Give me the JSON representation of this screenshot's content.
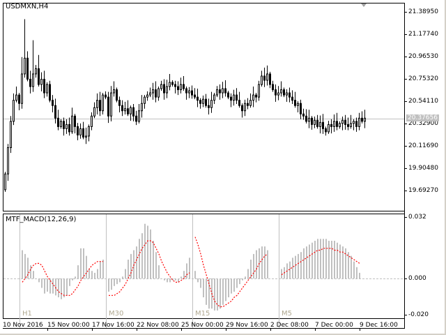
{
  "main": {
    "symbol_label": "USDMXN,H4",
    "current_price": "20.37656",
    "price_axis": [
      "21.38950",
      "21.17740",
      "20.96530",
      "20.75320",
      "20.54110",
      "20.32900",
      "20.11690",
      "19.90480",
      "19.69270"
    ],
    "colors": {
      "candle": "#000000",
      "grid_line": "#c0c0c0",
      "current_price_bg": "#c0c0c0"
    }
  },
  "indicator": {
    "title": "MTF_MACD(12,26,9)",
    "axis": [
      "0.032",
      "0.000",
      "-0.020"
    ],
    "timeframes": [
      "H1",
      "M30",
      "M15",
      "M5"
    ],
    "colors": {
      "histogram": "#c0c0c0",
      "signal": "#ff0000",
      "timeframe_label": "#b0a890"
    }
  },
  "time_axis": [
    "10 Nov 2016",
    "15 Nov 00:00",
    "17 Nov 16:00",
    "22 Nov 08:00",
    "25 Nov 00:00",
    "29 Nov 16:00",
    "2 Dec 08:00",
    "7 Dec 00:00",
    "9 Dec 16:00"
  ],
  "chart_data": [
    {
      "type": "candlestick",
      "title": "USDMXN,H4",
      "ylim": [
        19.55,
        21.45
      ],
      "open_first": 19.7,
      "closes": [
        19.85,
        20.1,
        20.35,
        20.55,
        20.6,
        20.52,
        20.8,
        20.95,
        20.75,
        20.68,
        20.8,
        20.85,
        20.7,
        20.75,
        20.62,
        20.7,
        20.55,
        20.5,
        20.38,
        20.3,
        20.35,
        20.28,
        20.32,
        20.25,
        20.4,
        20.3,
        20.22,
        20.28,
        20.2,
        20.21,
        20.3,
        20.4,
        20.48,
        20.55,
        20.45,
        20.6,
        20.58,
        20.4,
        20.62,
        20.65,
        20.55,
        20.5,
        20.45,
        20.47,
        20.42,
        20.48,
        20.4,
        20.35,
        20.45,
        20.52,
        20.58,
        20.6,
        20.62,
        20.65,
        20.58,
        20.66,
        20.7,
        20.62,
        20.68,
        20.72,
        20.7,
        20.68,
        20.65,
        20.7,
        20.66,
        20.62,
        20.64,
        20.6,
        20.58,
        20.55,
        20.52,
        20.56,
        20.5,
        20.48,
        20.55,
        20.6,
        20.65,
        20.62,
        20.66,
        20.62,
        20.58,
        20.55,
        20.6,
        20.55,
        20.5,
        20.45,
        20.52,
        20.5,
        20.55,
        20.6,
        20.58,
        20.7,
        20.78,
        20.74,
        20.8,
        20.7,
        20.65,
        20.6,
        20.62,
        20.65,
        20.6,
        20.62,
        20.58,
        20.55,
        20.5,
        20.52,
        20.42,
        20.4,
        20.35,
        20.38,
        20.32,
        20.36,
        20.3,
        20.34,
        20.28,
        20.25,
        20.32,
        20.3,
        20.35,
        20.3,
        20.33,
        20.36,
        20.32,
        20.3,
        20.33,
        20.35,
        20.3,
        20.38,
        20.35,
        20.38
      ],
      "high_overrides": {
        "7": 21.32,
        "10": 21.12,
        "12": 20.98,
        "6": 20.96,
        "93": 20.86
      }
    },
    {
      "type": "bar+line",
      "title": "MTF_MACD(12,26,9)",
      "ylim": [
        -0.02,
        0.032
      ],
      "segments": [
        {
          "name": "H1",
          "histogram": [
            15,
            13,
            11,
            7,
            4,
            0,
            -2,
            -5,
            -8,
            -7,
            -8,
            -8,
            -9,
            -10,
            -11,
            -10,
            -9,
            -4,
            -1,
            1,
            7,
            16,
            16,
            12,
            5,
            4,
            3,
            5,
            9,
            10
          ],
          "signal": [
            -2,
            0,
            2,
            5,
            7,
            8,
            8,
            7,
            4,
            1,
            -1,
            -3,
            -5,
            -7,
            -8,
            -9,
            -9,
            -9,
            -8,
            -6,
            -4,
            -1,
            1,
            3,
            5,
            7,
            8,
            9,
            9,
            9
          ]
        },
        {
          "name": "M30",
          "histogram": [
            -7,
            -6,
            -4,
            -3,
            -2,
            1,
            5,
            10,
            13,
            15,
            17,
            21,
            24,
            29,
            28,
            26,
            20,
            14,
            7,
            0,
            -1,
            -2,
            -2,
            -1,
            -1,
            -2,
            1,
            4,
            8,
            11
          ],
          "signal": [
            -9,
            -9,
            -9,
            -8,
            -7,
            -5,
            -3,
            0,
            3,
            7,
            10,
            13,
            16,
            18,
            20,
            20,
            19,
            16,
            13,
            9,
            6,
            3,
            1,
            -1,
            -2,
            -2,
            -1,
            0,
            2,
            3
          ]
        },
        {
          "name": "M15",
          "histogram": [
            4,
            -2,
            -5,
            -10,
            -14,
            -16,
            -16,
            -17,
            -17,
            -16,
            -14,
            -12,
            -10,
            -8,
            -7,
            -5,
            -3,
            -1,
            1,
            5,
            10,
            13,
            15,
            16,
            17,
            17,
            15
          ],
          "signal": [
            22,
            18,
            13,
            7,
            2,
            -3,
            -8,
            -12,
            -14,
            -15,
            -15,
            -14,
            -13,
            -12,
            -10,
            -9,
            -7,
            -5,
            -3,
            -1,
            1,
            3,
            5,
            8,
            10,
            12,
            13
          ]
        },
        {
          "name": "M5",
          "histogram": [
            5,
            6,
            8,
            9,
            11,
            12,
            13,
            14,
            16,
            17,
            18,
            19,
            20,
            21,
            21,
            21,
            21,
            20,
            20,
            20,
            19,
            18,
            17,
            16,
            14,
            12,
            9,
            6,
            3
          ],
          "signal": [
            2,
            3,
            4,
            5,
            6,
            7,
            8,
            9,
            10,
            11,
            12,
            13,
            14,
            15,
            15,
            16,
            16,
            16,
            16,
            15,
            15,
            14,
            14,
            13,
            12,
            11,
            10,
            9,
            8
          ]
        }
      ],
      "units": "0.001"
    }
  ]
}
